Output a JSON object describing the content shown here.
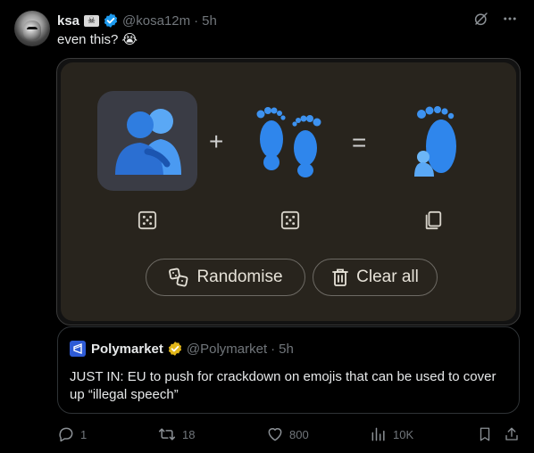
{
  "post": {
    "author_name": "ksa",
    "author_badge": "☠",
    "handle": "@kosa12m",
    "separator": "·",
    "time": "5h",
    "text": "even this? 😭"
  },
  "media": {
    "operator_plus": "+",
    "operator_equals": "=",
    "emojis": [
      "people-hugging",
      "footprints",
      "footprint-with-hugging-person"
    ],
    "randomise_label": "Randomise",
    "clear_label": "Clear all"
  },
  "quote": {
    "author_name": "Polymarket",
    "handle": "@Polymarket",
    "separator": "·",
    "time": "5h",
    "text": "JUST IN: EU to push for crackdown on emojis that can be used to cover up “illegal speech”"
  },
  "actions": {
    "replies": "1",
    "reposts": "18",
    "likes": "800",
    "views": "10K"
  },
  "colors": {
    "verified_blue": "#1d9bf0",
    "verified_gold": "#e2b719",
    "card_bg": "#28241d",
    "emoji_blue": "#2f8cf0"
  }
}
